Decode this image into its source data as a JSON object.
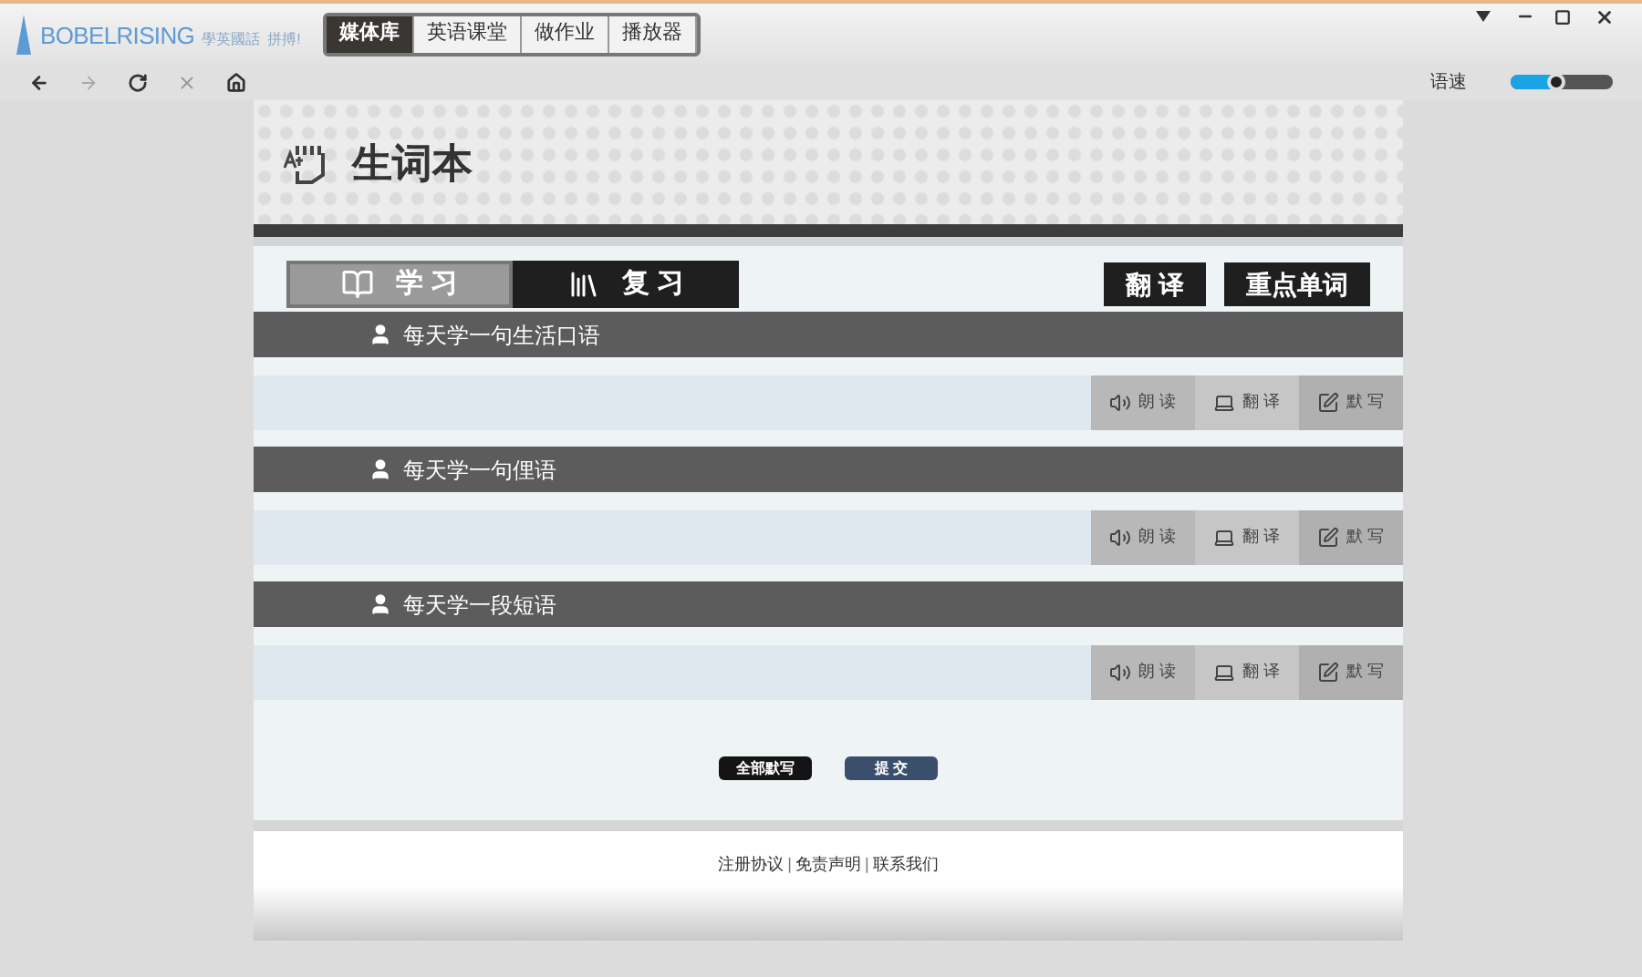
{
  "app": {
    "logo": "BOBELRISING",
    "slogan": "學英國話",
    "slogan2": "拼搏!"
  },
  "top_tabs": [
    {
      "label": "媒体库",
      "selected": true
    },
    {
      "label": "英语课堂",
      "selected": false
    },
    {
      "label": "做作业",
      "selected": false
    },
    {
      "label": "播放器",
      "selected": false
    }
  ],
  "speed": {
    "label": "语速",
    "level": 0.45
  },
  "page": {
    "title": "生词本"
  },
  "mode_tabs": [
    {
      "label": "学 习",
      "kind": "study",
      "selected": true
    },
    {
      "label": "复 习",
      "kind": "review",
      "selected": false
    }
  ],
  "right_buttons": [
    "翻 译",
    "重点单词"
  ],
  "sections": [
    {
      "title": "每天学一句生活口语",
      "actions": [
        {
          "label": "朗 读",
          "kind": "read"
        },
        {
          "label": "翻 译",
          "kind": "translate"
        },
        {
          "label": "默 写",
          "kind": "write"
        }
      ]
    },
    {
      "title": "每天学一句俚语",
      "actions": [
        {
          "label": "朗 读",
          "kind": "read"
        },
        {
          "label": "翻 译",
          "kind": "translate"
        },
        {
          "label": "默 写",
          "kind": "write"
        }
      ]
    },
    {
      "title": "每天学一段短语",
      "actions": [
        {
          "label": "朗 读",
          "kind": "read"
        },
        {
          "label": "翻 译",
          "kind": "translate"
        },
        {
          "label": "默 写",
          "kind": "write"
        }
      ]
    }
  ],
  "bottom_buttons": [
    {
      "label": "全部默写",
      "kind": "dark"
    },
    {
      "label": "提 交",
      "kind": "blue"
    }
  ],
  "footer": [
    {
      "text": "注册协议",
      "kind": "link"
    },
    {
      "text": "|",
      "kind": "separator"
    },
    {
      "text": "免责声明",
      "kind": "link"
    },
    {
      "text": "|",
      "kind": "separator"
    },
    {
      "text": "联系我们",
      "kind": "link"
    }
  ]
}
